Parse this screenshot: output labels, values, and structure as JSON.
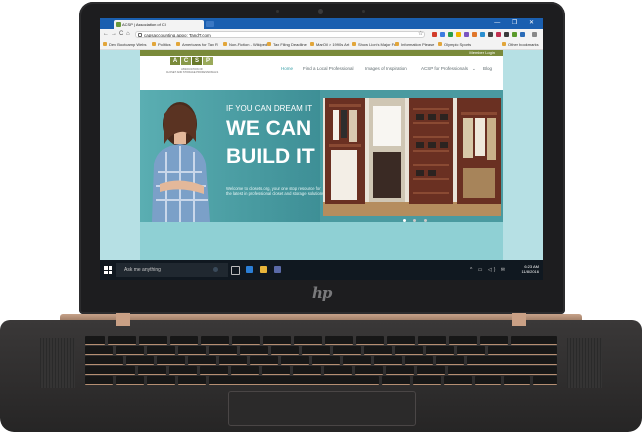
{
  "browser": {
    "tab_title": "ACSP | Association of Cl",
    "url": "capsaccounting.appo: TandT.com",
    "window_controls": "—  ❐  ✕",
    "bookmarks": [
      "Dev Bootcamp Webs",
      "Politics",
      "Americans for Tax R",
      "Non-Fiction - Wikipedia",
      "Tax Filing Deadline",
      "MarOil > 1990s Art",
      "Show Lion's Major Fe",
      "Information Please",
      "Olympic Sports"
    ],
    "other_bookmarks": "Other bookmarks",
    "nav_back": "←",
    "nav_forward": "→",
    "nav_reload": "C",
    "nav_home": "⌂",
    "star": "☆"
  },
  "site": {
    "member_login": "Member Login",
    "logo_letters": [
      "A",
      "C",
      "S",
      "P"
    ],
    "logo_line1": "ASSOCIATION OF",
    "logo_line2": "CLOSET AND STORAGE PROFESSIONALS",
    "menu": [
      {
        "label": "Home",
        "active": true
      },
      {
        "label": "Find a Local Professional",
        "active": false
      },
      {
        "label": "Images of Inspiration",
        "active": false
      },
      {
        "label": "ACSP for Professionals",
        "active": false
      },
      {
        "label": "Blog",
        "active": false
      }
    ],
    "menu_more": "⌄",
    "hero_line1": "IF YOU CAN DREAM IT",
    "hero_line2": "WE CAN",
    "hero_line3": "BUILD IT",
    "hero_copy": "Welcome to closets.org, your one stop resource for the latest in professional closet and storage solutions.",
    "slider_dots_active": 1,
    "slider_dots_count": 3
  },
  "taskbar": {
    "search_placeholder": "Ask me anything",
    "tray_icons": "^ ▭ ◁) ✉",
    "time": "6:23 AM",
    "date": "11/8/2016"
  },
  "device": {
    "brand": "hp"
  },
  "colors": {
    "browser_tabbar": "#1a5fb0",
    "site_accent": "#3aa0a8",
    "hero_teal": "#4a9aa0",
    "topstrip": "#7a8a3a",
    "laptop_bezel": "#1d1d1f",
    "hinge_copper": "#c7a38a"
  }
}
